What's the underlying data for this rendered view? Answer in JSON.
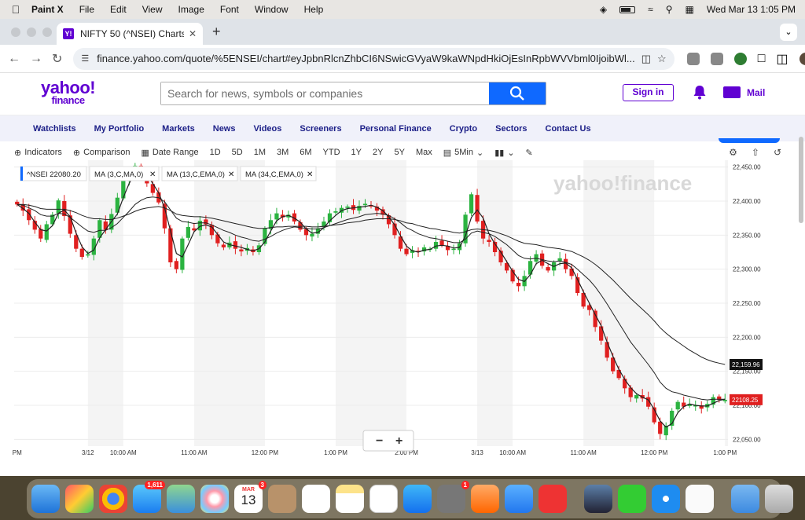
{
  "menubar": {
    "app_name": "Paint X",
    "items": [
      "File",
      "Edit",
      "View",
      "Image",
      "Font",
      "Window",
      "Help"
    ],
    "datetime": "Wed Mar 13  1:05 PM"
  },
  "browser": {
    "tab_title": "NIFTY 50 (^NSEI) Charts, Dat",
    "url": "finance.yahoo.com/quote/%5ENSEI/chart#eyJpbnRlcnZhbCI6NSwicGVyaW9kaWNpdHkiOjEsInRpbWVVbml0IjoibWl..."
  },
  "yahoo": {
    "logo_text": "yahoo!",
    "logo_sub": "finance",
    "search_placeholder": "Search for news, symbols or companies",
    "signin_label": "Sign in",
    "mail_label": "Mail",
    "nav_items": [
      "Watchlists",
      "My Portfolio",
      "Markets",
      "News",
      "Videos",
      "Screeners",
      "Personal Finance",
      "Crypto",
      "Sectors",
      "Contact Us"
    ]
  },
  "chart_toolbar": {
    "indicators_label": "Indicators",
    "comparison_label": "Comparison",
    "date_range_label": "Date Range",
    "ranges": [
      "1D",
      "5D",
      "1M",
      "3M",
      "6M",
      "YTD",
      "1Y",
      "2Y",
      "5Y",
      "Max"
    ],
    "interval_label": "5Min"
  },
  "chart_data": {
    "type": "candlestick",
    "symbol": "^NSEI",
    "last_value": "22080.20",
    "indicators": [
      "MA (3,C,MA,0)",
      "MA (13,C,EMA,0)",
      "MA (34,C,EMA,0)"
    ],
    "watermark": "yahoo!finance",
    "ylim": [
      22040,
      22460
    ],
    "yticks": [
      22050,
      22100,
      22150,
      22200,
      22250,
      22300,
      22350,
      22400,
      22450
    ],
    "ytick_labels": [
      "22,050.00",
      "22,100.00",
      "22,150.00",
      "22,200.00",
      "22,250.00",
      "22,300.00",
      "22,350.00",
      "22,400.00",
      "22,450.00"
    ],
    "xticks": [
      {
        "label": "PM",
        "idx": 0
      },
      {
        "label": "3/12",
        "idx": 12
      },
      {
        "label": "10:00 AM",
        "idx": 18
      },
      {
        "label": "11:00 AM",
        "idx": 30
      },
      {
        "label": "12:00 PM",
        "idx": 42
      },
      {
        "label": "1:00 PM",
        "idx": 54
      },
      {
        "label": "2:00 PM",
        "idx": 66
      },
      {
        "label": "3/13",
        "idx": 78
      },
      {
        "label": "10:00 AM",
        "idx": 84
      },
      {
        "label": "11:00 AM",
        "idx": 96
      },
      {
        "label": "12:00 PM",
        "idx": 108
      },
      {
        "label": "1:00 PM",
        "idx": 120
      }
    ],
    "price_tags": [
      {
        "label": "22,159.96",
        "value": 22159.96,
        "color": "#111111"
      },
      {
        "label": "22108.25",
        "value": 22108.25,
        "color": "#e02020"
      }
    ],
    "candles_close": [
      22395,
      22386,
      22372,
      22358,
      22345,
      22366,
      22380,
      22401,
      22378,
      22352,
      22330,
      22318,
      22322,
      22345,
      22372,
      22358,
      22381,
      22405,
      22430,
      22442,
      22452,
      22440,
      22426,
      22412,
      22398,
      22360,
      22310,
      22300,
      22345,
      22362,
      22357,
      22371,
      22366,
      22350,
      22338,
      22332,
      22339,
      22330,
      22326,
      22331,
      22325,
      22335,
      22360,
      22372,
      22382,
      22376,
      22380,
      22370,
      22358,
      22350,
      22352,
      22360,
      22370,
      22382,
      22385,
      22390,
      22392,
      22387,
      22393,
      22396,
      22392,
      22386,
      22380,
      22366,
      22350,
      22330,
      22322,
      22328,
      22325,
      22332,
      22330,
      22340,
      22335,
      22328,
      22330,
      22338,
      22380,
      22410,
      22370,
      22345,
      22340,
      22325,
      22310,
      22298,
      22282,
      22275,
      22290,
      22312,
      22322,
      22305,
      22298,
      22310,
      22316,
      22300,
      22290,
      22265,
      22245,
      22240,
      22215,
      22195,
      22170,
      22150,
      22140,
      22125,
      22112,
      22115,
      22110,
      22098,
      22075,
      22058,
      22070,
      22092,
      22105,
      22098,
      22102,
      22100,
      22095,
      22102,
      22112,
      22108,
      22108
    ],
    "ma3": [
      22395,
      22389,
      22382,
      22369,
      22358,
      22356,
      22364,
      22382,
      22387,
      22377,
      22353,
      22333,
      22323,
      22328,
      22346,
      22358,
      22370,
      22381,
      22405,
      22426,
      22441,
      22445,
      22439,
      22426,
      22412,
      22390,
      22356,
      22323,
      22318,
      22336,
      22355,
      22363,
      22365,
      22362,
      22351,
      22340,
      22336,
      22334,
      22332,
      22329,
      22327,
      22330,
      22340,
      22356,
      22371,
      22377,
      22379,
      22375,
      22369,
      22359,
      22353,
      22354,
      22361,
      22371,
      22379,
      22386,
      22389,
      22390,
      22391,
      22392,
      22394,
      22391,
      22386,
      22377,
      22365,
      22349,
      22334,
      22327,
      22325,
      22328,
      22329,
      22334,
      22335,
      22334,
      22331,
      22332,
      22349,
      22376,
      22387,
      22375,
      22352,
      22337,
      22325,
      22311,
      22297,
      22285,
      22282,
      22292,
      22308,
      22313,
      22308,
      22304,
      22308,
      22309,
      22302,
      22285,
      22267,
      22250,
      22233,
      22217,
      22193,
      22172,
      22153,
      22138,
      22126,
      22117,
      22112,
      22108,
      22094,
      22077,
      22068,
      22073,
      22089,
      22098,
      22102,
      22100,
      22099,
      22099,
      22103,
      22107,
      22109
    ],
    "ema13": [
      22395,
      22394,
      22390,
      22386,
      22380,
      22378,
      22378,
      22382,
      22381,
      22376,
      22369,
      22362,
      22356,
      22354,
      22357,
      22357,
      22361,
      22367,
      22376,
      22385,
      22395,
      22401,
      22405,
      22406,
      22405,
      22399,
      22387,
      22375,
      22370,
      22369,
      22367,
      22368,
      22368,
      22365,
      22361,
      22357,
      22354,
      22350,
      22347,
      22345,
      22342,
      22341,
      22344,
      22348,
      22353,
      22357,
      22360,
      22362,
      22361,
      22360,
      22359,
      22359,
      22361,
      22364,
      22367,
      22370,
      22373,
      22375,
      22377,
      22380,
      22381,
      22382,
      22381,
      22379,
      22374,
      22368,
      22361,
      22357,
      22352,
      22349,
      22346,
      22345,
      22343,
      22341,
      22339,
      22339,
      22344,
      22353,
      22356,
      22354,
      22352,
      22348,
      22342,
      22336,
      22328,
      22320,
      22316,
      22315,
      22316,
      22314,
      22312,
      22311,
      22312,
      22310,
      22307,
      22300,
      22292,
      22284,
      22274,
      22262,
      22249,
      22235,
      22221,
      22207,
      22193,
      22182,
      22171,
      22160,
      22148,
      22134,
      22125,
      22120,
      22118,
      22115,
      22113,
      22111,
      22109,
      22108,
      22109,
      22109,
      22109
    ],
    "ema34": [
      22395,
      22395,
      22394,
      22392,
      22389,
      22388,
      22388,
      22388,
      22388,
      22386,
      22383,
      22379,
      22376,
      22374,
      22374,
      22373,
      22373,
      22375,
      22378,
      22381,
      22385,
      22388,
      22390,
      22391,
      22392,
      22390,
      22386,
      22381,
      22379,
      22378,
      22377,
      22377,
      22376,
      22375,
      22373,
      22371,
      22369,
      22367,
      22365,
      22363,
      22361,
      22360,
      22360,
      22361,
      22362,
      22362,
      22363,
      22363,
      22363,
      22363,
      22362,
      22362,
      22363,
      22364,
      22365,
      22366,
      22368,
      22369,
      22370,
      22372,
      22373,
      22374,
      22374,
      22374,
      22373,
      22371,
      22368,
      22367,
      22364,
      22362,
      22360,
      22359,
      22357,
      22356,
      22354,
      22353,
      22355,
      22358,
      22359,
      22358,
      22357,
      22355,
      22352,
      22349,
      22345,
      22341,
      22338,
      22337,
      22336,
      22334,
      22332,
      22331,
      22330,
      22328,
      22326,
      22322,
      22318,
      22313,
      22307,
      22300,
      22292,
      22284,
      22275,
      22266,
      22257,
      22249,
      22241,
      22233,
      22224,
      22214,
      22206,
      22199,
      22193,
      22187,
      22181,
      22176,
      22171,
      22167,
      22164,
      22162,
      22160
    ]
  },
  "dock": {
    "calendar_month": "MAR",
    "calendar_day": "13",
    "mail_badge": "1,611",
    "calendar_badge": "3",
    "settings_badge": "1"
  }
}
